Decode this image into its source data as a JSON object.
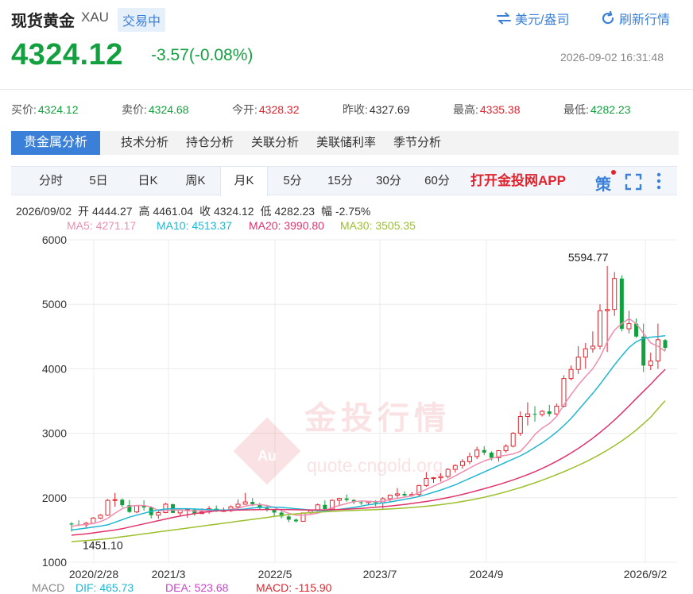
{
  "header": {
    "title": "现货黄金",
    "code": "XAU",
    "status": "交易中",
    "unit_toggle": "美元/盎司",
    "refresh": "刷新行情",
    "price": "4324.12",
    "change": "-3.57(-0.08%)",
    "datetime": "2026-09-02 16:31:48"
  },
  "stats": [
    {
      "label": "买价:",
      "value": "4324.12",
      "color": "#13a13f"
    },
    {
      "label": "卖价:",
      "value": "4324.68",
      "color": "#13a13f"
    },
    {
      "label": "今开:",
      "value": "4328.32",
      "color": "#e0242e"
    },
    {
      "label": "昨收:",
      "value": "4327.69",
      "color": "#333333"
    },
    {
      "label": "最高:",
      "value": "4335.38",
      "color": "#e0242e"
    },
    {
      "label": "最低:",
      "value": "4282.23",
      "color": "#13a13f"
    }
  ],
  "panel_tabs": [
    "贵金属分析",
    "技术分析",
    "持仓分析",
    "关联分析",
    "美联储利率",
    "季节分析"
  ],
  "period_tabs": [
    "分时",
    "5日",
    "日K",
    "周K",
    "月K",
    "5分",
    "15分",
    "30分",
    "60分"
  ],
  "active_period": 4,
  "app_link": "打开金投网APP",
  "strategy_icon": "策",
  "ohlc": {
    "date": "2026/09/02",
    "open_label": "开",
    "open": "4444.27",
    "high_label": "高",
    "high": "4461.04",
    "close_label": "收",
    "close": "4324.12",
    "low_label": "低",
    "low": "4282.23",
    "range_label": "幅",
    "range": "-2.75%"
  },
  "ma": [
    {
      "label": "MA5: 4271.17",
      "color": "#f08cb0"
    },
    {
      "label": "MA10: 4513.37",
      "color": "#1fb6d3"
    },
    {
      "label": "MA20: 3990.80",
      "color": "#e0336b"
    },
    {
      "label": "MA30: 3505.35",
      "color": "#9bc02c"
    }
  ],
  "macd": [
    {
      "label": "MACD",
      "color": "#888888"
    },
    {
      "label": "DIF: 465.73",
      "color": "#1fb6d3"
    },
    {
      "label": "DEA: 523.68",
      "color": "#c845c8"
    },
    {
      "label": "MACD: -115.90",
      "color": "#e0242e"
    }
  ],
  "watermark": {
    "text": "金投行情",
    "url": "quote.cngold.org",
    "logo": "Au"
  },
  "colors": {
    "up": "#e0242e",
    "down": "#13a13f",
    "accent": "#3a80d8"
  },
  "chart_data": {
    "type": "candlestick",
    "interval": "monthly",
    "x_ticks": [
      "2020/2/28",
      "2021/3",
      "2022/5",
      "2023/7",
      "2024/9",
      "2026/9/2"
    ],
    "y_ticks": [
      1000,
      2000,
      3000,
      4000,
      5000,
      6000
    ],
    "ylim": [
      1000,
      6000
    ],
    "annotations": [
      {
        "text": "5594.77",
        "kind": "max"
      },
      {
        "text": "1451.10",
        "kind": "min"
      }
    ],
    "candles": [
      {
        "o": 1600,
        "h": 1620,
        "l": 1475,
        "c": 1585
      },
      {
        "o": 1585,
        "h": 1650,
        "l": 1560,
        "c": 1580
      },
      {
        "o": 1580,
        "h": 1625,
        "l": 1540,
        "c": 1605
      },
      {
        "o": 1605,
        "h": 1700,
        "l": 1590,
        "c": 1685
      },
      {
        "o": 1685,
        "h": 1745,
        "l": 1670,
        "c": 1730
      },
      {
        "o": 1730,
        "h": 1980,
        "l": 1720,
        "c": 1960
      },
      {
        "o": 1960,
        "h": 2075,
        "l": 1860,
        "c": 1970
      },
      {
        "o": 1970,
        "h": 1990,
        "l": 1850,
        "c": 1885
      },
      {
        "o": 1885,
        "h": 1965,
        "l": 1765,
        "c": 1780
      },
      {
        "o": 1780,
        "h": 1880,
        "l": 1760,
        "c": 1875
      },
      {
        "o": 1875,
        "h": 1960,
        "l": 1800,
        "c": 1850
      },
      {
        "o": 1850,
        "h": 1870,
        "l": 1680,
        "c": 1730
      },
      {
        "o": 1730,
        "h": 1800,
        "l": 1675,
        "c": 1770
      },
      {
        "o": 1770,
        "h": 1920,
        "l": 1760,
        "c": 1900
      },
      {
        "o": 1900,
        "h": 1910,
        "l": 1770,
        "c": 1765
      },
      {
        "o": 1765,
        "h": 1835,
        "l": 1720,
        "c": 1810
      },
      {
        "o": 1810,
        "h": 1830,
        "l": 1690,
        "c": 1815
      },
      {
        "o": 1815,
        "h": 1835,
        "l": 1720,
        "c": 1755
      },
      {
        "o": 1755,
        "h": 1835,
        "l": 1745,
        "c": 1780
      },
      {
        "o": 1780,
        "h": 1870,
        "l": 1750,
        "c": 1830
      },
      {
        "o": 1830,
        "h": 1880,
        "l": 1780,
        "c": 1795
      },
      {
        "o": 1795,
        "h": 1850,
        "l": 1780,
        "c": 1800
      },
      {
        "o": 1800,
        "h": 1880,
        "l": 1780,
        "c": 1860
      },
      {
        "o": 1860,
        "h": 1975,
        "l": 1800,
        "c": 1900
      },
      {
        "o": 1900,
        "h": 2075,
        "l": 1890,
        "c": 1935
      },
      {
        "o": 1935,
        "h": 1995,
        "l": 1870,
        "c": 1900
      },
      {
        "o": 1900,
        "h": 1920,
        "l": 1810,
        "c": 1840
      },
      {
        "o": 1840,
        "h": 1880,
        "l": 1785,
        "c": 1810
      },
      {
        "o": 1810,
        "h": 1820,
        "l": 1700,
        "c": 1770
      },
      {
        "o": 1770,
        "h": 1790,
        "l": 1680,
        "c": 1710
      },
      {
        "o": 1710,
        "h": 1730,
        "l": 1620,
        "c": 1660
      },
      {
        "o": 1660,
        "h": 1680,
        "l": 1615,
        "c": 1635
      },
      {
        "o": 1635,
        "h": 1770,
        "l": 1630,
        "c": 1765
      },
      {
        "o": 1765,
        "h": 1815,
        "l": 1750,
        "c": 1800
      },
      {
        "o": 1800,
        "h": 1910,
        "l": 1790,
        "c": 1890
      },
      {
        "o": 1890,
        "h": 1960,
        "l": 1800,
        "c": 1825
      },
      {
        "o": 1825,
        "h": 1975,
        "l": 1810,
        "c": 1960
      },
      {
        "o": 1960,
        "h": 2000,
        "l": 1880,
        "c": 1990
      },
      {
        "o": 1990,
        "h": 2050,
        "l": 1940,
        "c": 1965
      },
      {
        "o": 1965,
        "h": 1980,
        "l": 1900,
        "c": 1930
      },
      {
        "o": 1930,
        "h": 1960,
        "l": 1890,
        "c": 1925
      },
      {
        "o": 1925,
        "h": 1950,
        "l": 1880,
        "c": 1945
      },
      {
        "o": 1945,
        "h": 1960,
        "l": 1870,
        "c": 1920
      },
      {
        "o": 1920,
        "h": 2010,
        "l": 1830,
        "c": 1985
      },
      {
        "o": 1985,
        "h": 2050,
        "l": 1930,
        "c": 2040
      },
      {
        "o": 2040,
        "h": 2150,
        "l": 2000,
        "c": 2060
      },
      {
        "o": 2060,
        "h": 2100,
        "l": 2020,
        "c": 2035
      },
      {
        "o": 2035,
        "h": 2090,
        "l": 2015,
        "c": 2050
      },
      {
        "o": 2050,
        "h": 2200,
        "l": 2020,
        "c": 2190
      },
      {
        "o": 2190,
        "h": 2400,
        "l": 2170,
        "c": 2300
      },
      {
        "o": 2300,
        "h": 2320,
        "l": 2230,
        "c": 2310
      },
      {
        "o": 2310,
        "h": 2380,
        "l": 2250,
        "c": 2330
      },
      {
        "o": 2330,
        "h": 2460,
        "l": 2300,
        "c": 2440
      },
      {
        "o": 2440,
        "h": 2520,
        "l": 2390,
        "c": 2500
      },
      {
        "o": 2500,
        "h": 2600,
        "l": 2450,
        "c": 2560
      },
      {
        "o": 2560,
        "h": 2700,
        "l": 2520,
        "c": 2640
      },
      {
        "o": 2640,
        "h": 2790,
        "l": 2600,
        "c": 2740
      },
      {
        "o": 2740,
        "h": 2800,
        "l": 2660,
        "c": 2700
      },
      {
        "o": 2700,
        "h": 2720,
        "l": 2580,
        "c": 2620
      },
      {
        "o": 2620,
        "h": 2740,
        "l": 2560,
        "c": 2730
      },
      {
        "o": 2730,
        "h": 2830,
        "l": 2700,
        "c": 2800
      },
      {
        "o": 2800,
        "h": 3020,
        "l": 2780,
        "c": 3000
      },
      {
        "o": 3000,
        "h": 3340,
        "l": 2960,
        "c": 3260
      },
      {
        "o": 3260,
        "h": 3480,
        "l": 3120,
        "c": 3300
      },
      {
        "o": 3300,
        "h": 3420,
        "l": 3180,
        "c": 3290
      },
      {
        "o": 3290,
        "h": 3360,
        "l": 3260,
        "c": 3340
      },
      {
        "o": 3340,
        "h": 3440,
        "l": 3260,
        "c": 3300
      },
      {
        "o": 3300,
        "h": 3460,
        "l": 3280,
        "c": 3420
      },
      {
        "o": 3420,
        "h": 3900,
        "l": 3400,
        "c": 3850
      },
      {
        "o": 3850,
        "h": 4050,
        "l": 3820,
        "c": 3990
      },
      {
        "o": 3990,
        "h": 4350,
        "l": 3920,
        "c": 4180
      },
      {
        "o": 4180,
        "h": 4400,
        "l": 4000,
        "c": 4310
      },
      {
        "o": 4310,
        "h": 4580,
        "l": 4250,
        "c": 4350
      },
      {
        "o": 4350,
        "h": 5000,
        "l": 4300,
        "c": 4900
      },
      {
        "o": 4900,
        "h": 5594.77,
        "l": 4260,
        "c": 4920
      },
      {
        "o": 4920,
        "h": 5500,
        "l": 4820,
        "c": 5400
      },
      {
        "o": 5400,
        "h": 5450,
        "l": 4580,
        "c": 4620
      },
      {
        "o": 4620,
        "h": 4900,
        "l": 4550,
        "c": 4700
      },
      {
        "o": 4700,
        "h": 4780,
        "l": 4480,
        "c": 4500
      },
      {
        "o": 4500,
        "h": 4700,
        "l": 3950,
        "c": 4050
      },
      {
        "o": 4050,
        "h": 4250,
        "l": 3980,
        "c": 4120
      },
      {
        "o": 4120,
        "h": 4700,
        "l": 4000,
        "c": 4450
      },
      {
        "o": 4444.27,
        "h": 4461.04,
        "l": 4282.23,
        "c": 4324.12
      }
    ],
    "ma_lines": [
      {
        "name": "MA5",
        "color": "#f08cb0",
        "values": [
          1555,
          1575,
          1585,
          1600,
          1630,
          1680,
          1760,
          1830,
          1870,
          1880,
          1880,
          1860,
          1800,
          1800,
          1810,
          1810,
          1800,
          1795,
          1800,
          1800,
          1800,
          1800,
          1820,
          1840,
          1870,
          1890,
          1895,
          1880,
          1850,
          1800,
          1760,
          1730,
          1730,
          1740,
          1760,
          1800,
          1850,
          1880,
          1910,
          1940,
          1950,
          1945,
          1940,
          1945,
          1970,
          1990,
          2010,
          2030,
          2080,
          2130,
          2180,
          2230,
          2280,
          2340,
          2400,
          2460,
          2520,
          2570,
          2610,
          2640,
          2660,
          2680,
          2720,
          2840,
          2980,
          3080,
          3150,
          3260,
          3440,
          3600,
          3750,
          3880,
          4000,
          4180,
          4420,
          4600,
          4700,
          4780,
          4700,
          4550,
          4400,
          4350,
          4271.17
        ]
      },
      {
        "name": "MA10",
        "color": "#1fb6d3",
        "values": [
          1500,
          1515,
          1530,
          1545,
          1560,
          1580,
          1620,
          1660,
          1700,
          1730,
          1760,
          1790,
          1810,
          1825,
          1830,
          1830,
          1830,
          1825,
          1820,
          1815,
          1810,
          1810,
          1812,
          1815,
          1825,
          1840,
          1850,
          1855,
          1855,
          1850,
          1840,
          1830,
          1820,
          1810,
          1800,
          1800,
          1810,
          1820,
          1835,
          1850,
          1870,
          1890,
          1905,
          1920,
          1935,
          1955,
          1975,
          1995,
          2020,
          2050,
          2085,
          2120,
          2160,
          2200,
          2250,
          2300,
          2350,
          2400,
          2450,
          2500,
          2550,
          2600,
          2650,
          2710,
          2780,
          2850,
          2930,
          3020,
          3120,
          3230,
          3360,
          3490,
          3620,
          3760,
          3910,
          4060,
          4200,
          4330,
          4420,
          4470,
          4490,
          4500,
          4513.37
        ]
      },
      {
        "name": "MA20",
        "color": "#e0336b",
        "values": [
          1420,
          1430,
          1440,
          1455,
          1470,
          1485,
          1500,
          1520,
          1545,
          1570,
          1595,
          1620,
          1645,
          1670,
          1695,
          1715,
          1735,
          1755,
          1770,
          1785,
          1795,
          1800,
          1805,
          1810,
          1812,
          1814,
          1816,
          1818,
          1818,
          1818,
          1816,
          1814,
          1812,
          1812,
          1812,
          1812,
          1814,
          1818,
          1822,
          1828,
          1835,
          1843,
          1852,
          1862,
          1872,
          1884,
          1897,
          1911,
          1926,
          1942,
          1960,
          1980,
          2002,
          2026,
          2052,
          2080,
          2110,
          2140,
          2172,
          2205,
          2240,
          2277,
          2316,
          2358,
          2404,
          2454,
          2508,
          2566,
          2628,
          2694,
          2766,
          2842,
          2924,
          3012,
          3106,
          3206,
          3312,
          3424,
          3540,
          3650,
          3760,
          3880,
          3990.8
        ]
      },
      {
        "name": "MA30",
        "color": "#9bc02c",
        "values": [
          1320,
          1328,
          1336,
          1345,
          1355,
          1365,
          1380,
          1395,
          1410,
          1425,
          1440,
          1455,
          1470,
          1485,
          1500,
          1515,
          1530,
          1545,
          1560,
          1575,
          1590,
          1605,
          1620,
          1635,
          1650,
          1665,
          1680,
          1695,
          1710,
          1725,
          1740,
          1750,
          1760,
          1768,
          1776,
          1782,
          1788,
          1794,
          1800,
          1804,
          1808,
          1812,
          1816,
          1820,
          1826,
          1832,
          1840,
          1848,
          1858,
          1868,
          1880,
          1893,
          1908,
          1924,
          1942,
          1962,
          1984,
          2008,
          2034,
          2062,
          2092,
          2124,
          2158,
          2194,
          2232,
          2272,
          2314,
          2358,
          2404,
          2452,
          2502,
          2555,
          2612,
          2672,
          2738,
          2808,
          2882,
          2962,
          3050,
          3148,
          3250,
          3380,
          3505.35
        ]
      }
    ]
  }
}
